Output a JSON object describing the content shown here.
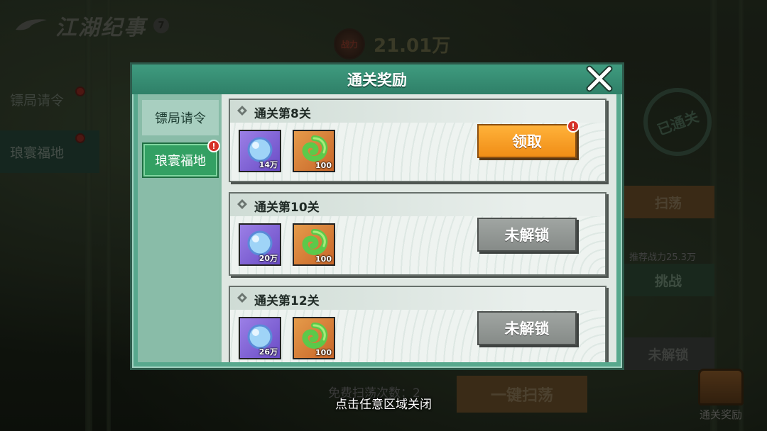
{
  "background": {
    "game_title": "江湖纪事",
    "help_badge": "7",
    "power_icon_label": "战力",
    "power_value": "21.01万",
    "left_tabs": [
      {
        "label": "镖局请令"
      },
      {
        "label": "琅寰福地"
      }
    ],
    "right_col": {
      "stamp_label": "已通关",
      "sweep_label": "扫荡",
      "recommend_label": "推荐战力25.3万",
      "challenge_label": "挑战",
      "locked_label": "未解锁"
    },
    "free_sweep_text": "免费扫荡次数：2",
    "one_click_sweep": "一键扫荡",
    "reward_label": "通关奖励"
  },
  "modal": {
    "title": "通关奖励",
    "close_hint": "点击任意区域关闭",
    "tabs": [
      {
        "label": "镖局请令",
        "active": false
      },
      {
        "label": "琅寰福地",
        "active": true,
        "badge": "!"
      }
    ],
    "cards": [
      {
        "title": "通关第8关",
        "items": [
          {
            "icon": "purple-orb-icon",
            "qty": "14万"
          },
          {
            "icon": "green-swirl-icon",
            "qty": "100"
          }
        ],
        "action": {
          "label": "领取",
          "state": "claim",
          "badge": "!"
        }
      },
      {
        "title": "通关第10关",
        "items": [
          {
            "icon": "purple-orb-icon",
            "qty": "20万"
          },
          {
            "icon": "green-swirl-icon",
            "qty": "100"
          }
        ],
        "action": {
          "label": "未解锁",
          "state": "locked"
        }
      },
      {
        "title": "通关第12关",
        "items": [
          {
            "icon": "purple-orb-icon",
            "qty": "26万"
          },
          {
            "icon": "green-swirl-icon",
            "qty": "100"
          }
        ],
        "action": {
          "label": "未解锁",
          "state": "locked"
        }
      }
    ]
  },
  "colors": {
    "modal_frame": "#57a88d",
    "active_tab": "#33a063",
    "claim_button": "#f5991f",
    "locked_button": "#8f9491",
    "badge_red": "#d6322a"
  }
}
